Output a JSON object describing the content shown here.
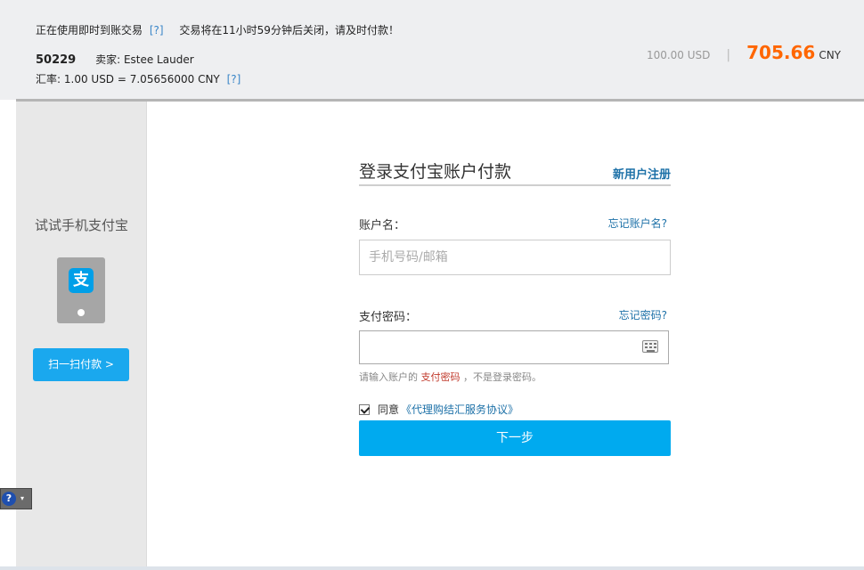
{
  "header": {
    "trade_type": "正在使用即时到账交易",
    "help1": "[?]",
    "close_notice": "交易将在11小时59分钟后关闭，请及时付款！",
    "order_no": "50229",
    "seller_label": "卖家:",
    "seller_name": "Estee Lauder",
    "rate_label": "汇率:",
    "rate_value": "1.00 USD = 7.05656000 CNY",
    "help2": "[?]",
    "amount_usd": "100.00 USD",
    "amount_sep": "|",
    "amount_cny": "705.66",
    "cny_unit": "CNY"
  },
  "left_panel": {
    "title": "试试手机支付宝",
    "phone_logo": "支",
    "scan_button": "扫一扫付款 >"
  },
  "login": {
    "title": "登录支付宝账户付款",
    "register": "新用户注册",
    "account_label": "账户名：",
    "forgot_account": "忘记账户名?",
    "account_placeholder": "手机号码/邮箱",
    "password_label": "支付密码：",
    "forgot_password": "忘记密码?",
    "hint_prefix": "请输入账户的",
    "hint_highlight": "支付密码",
    "hint_suffix": "，不是登录密码。",
    "agree_text": "同意",
    "agree_link": "《代理购结汇服务协议》",
    "next_button": "下一步"
  },
  "help_widget": {
    "icon": "?",
    "dropdown": "▾"
  },
  "colors": {
    "accent": "#00aaef",
    "amount": "#ff6600",
    "link": "#1d71a8"
  }
}
